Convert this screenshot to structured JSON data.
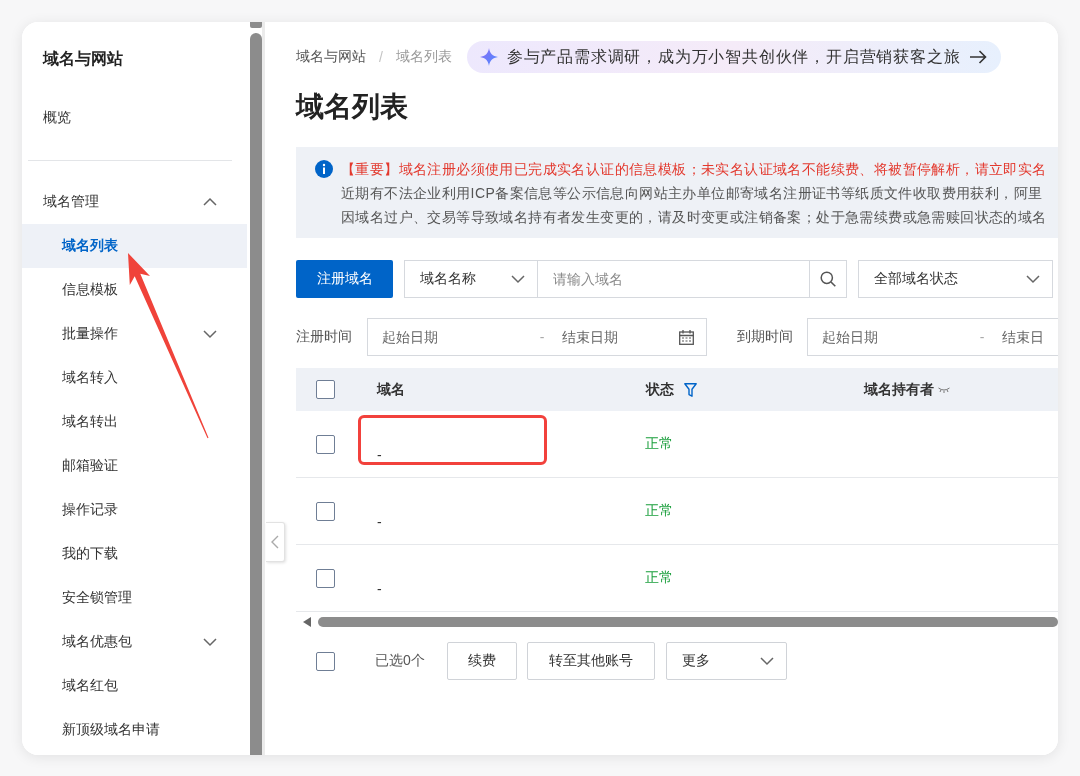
{
  "sidebar": {
    "title": "域名与网站",
    "sections": [
      {
        "items": [
          {
            "label": "概览",
            "selected": false
          }
        ]
      },
      {
        "items": [
          {
            "label": "域名管理",
            "selected": false,
            "expanded": true,
            "children": [
              {
                "label": "域名列表",
                "selected": true
              },
              {
                "label": "信息模板",
                "selected": false
              },
              {
                "label": "批量操作",
                "selected": false,
                "expanded": false
              },
              {
                "label": "域名转入",
                "selected": false
              },
              {
                "label": "域名转出",
                "selected": false
              },
              {
                "label": "邮箱验证",
                "selected": false
              },
              {
                "label": "操作记录",
                "selected": false
              },
              {
                "label": "我的下载",
                "selected": false
              },
              {
                "label": "安全锁管理",
                "selected": false
              },
              {
                "label": "域名优惠包",
                "selected": false,
                "expanded": false
              },
              {
                "label": "域名红包",
                "selected": false
              },
              {
                "label": "新顶级域名申请",
                "selected": false
              }
            ]
          }
        ]
      }
    ]
  },
  "breadcrumb": {
    "items": [
      "域名与网站",
      "域名列表"
    ],
    "separator": "/"
  },
  "promo_banner": {
    "text": "参与产品需求调研，成为万小智共创伙伴，开启营销获客之旅"
  },
  "page_title": "域名列表",
  "notice": {
    "lines": [
      {
        "kind": "important",
        "text": "【重要】域名注册必须使用已完成实名认证的信息模板；未实名认证域名不能续费、将被暂停解析，请立即实名"
      },
      {
        "kind": "plain",
        "text": "近期有不法企业利用ICP备案信息等公示信息向网站主办单位邮寄域名注册证书等纸质文件收取费用获利，阿里"
      },
      {
        "kind": "plain",
        "text": "因域名过户、交易等导致域名持有者发生变更的，请及时变更或注销备案；处于急需续费或急需赎回状态的域名"
      }
    ]
  },
  "toolbar": {
    "register_button": "注册域名",
    "search_field_select": "域名名称",
    "search_placeholder": "请输入域名",
    "status_select": "全部域名状态"
  },
  "date_filters": [
    {
      "label": "注册时间",
      "start_placeholder": "起始日期",
      "separator": "-",
      "end_placeholder": "结束日期"
    },
    {
      "label": "到期时间",
      "start_placeholder": "起始日期",
      "separator": "-",
      "end_placeholder": "结束日"
    }
  ],
  "table": {
    "select_all_checked": false,
    "columns": [
      {
        "label": "域名",
        "kind": "plain"
      },
      {
        "label": "状态",
        "kind": "filterable"
      },
      {
        "label": "域名持有者",
        "kind": "maskable"
      }
    ],
    "rows": [
      {
        "checked": false,
        "highlighted": true,
        "domain": "-",
        "status": "正常"
      },
      {
        "checked": false,
        "highlighted": false,
        "domain": "-",
        "status": "正常"
      },
      {
        "checked": false,
        "highlighted": false,
        "domain": "-",
        "status": "正常"
      }
    ]
  },
  "footer": {
    "select_all_checked": false,
    "selected_count": "已选0个",
    "buttons": [
      "续费",
      "转至其他账号"
    ],
    "more_select": "更多"
  }
}
